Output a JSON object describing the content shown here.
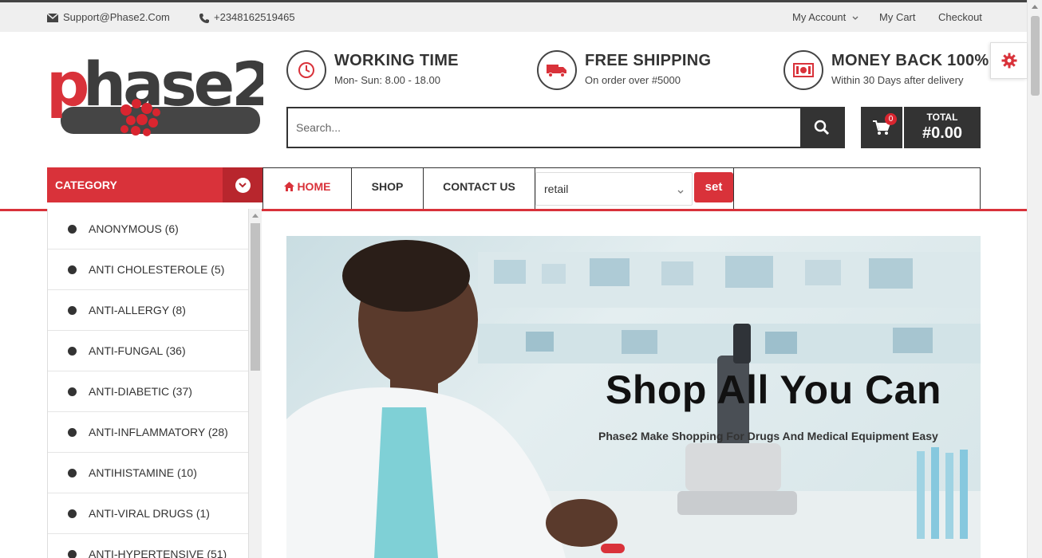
{
  "topbar": {
    "email": "Support@Phase2.Com",
    "phone": "+2348162519465",
    "my_account": "My Account",
    "my_cart": "My Cart",
    "checkout": "Checkout"
  },
  "info_blocks": [
    {
      "title": "WORKING TIME",
      "subtitle": "Mon- Sun: 8.00 - 18.00",
      "icon": "clock-icon"
    },
    {
      "title": "FREE SHIPPING",
      "subtitle": "On order over #5000",
      "icon": "truck-icon"
    },
    {
      "title": "MONEY BACK 100%",
      "subtitle": "Within 30 Days after delivery",
      "icon": "money-icon"
    }
  ],
  "search": {
    "placeholder": "Search..."
  },
  "cart": {
    "count": "0",
    "total_label": "TOTAL",
    "total_value": "#0.00"
  },
  "category": {
    "header": "CATEGORY"
  },
  "nav": {
    "home": "HOME",
    "shop": "SHOP",
    "contact": "CONTACT US",
    "select_value": "retail",
    "set_label": "set"
  },
  "categories": [
    "ANONYMOUS (6)",
    "ANTI CHOLESTEROLE (5)",
    "ANTI-ALLERGY (8)",
    "ANTI-FUNGAL (36)",
    "ANTI-DIABETIC (37)",
    "ANTI-INFLAMMATORY (28)",
    "ANTIHISTAMINE (10)",
    "ANTI-VIRAL DRUGS (1)",
    "ANTI-HYPERTENSIVE (51)"
  ],
  "banner": {
    "headline": "Shop All You Can",
    "tagline": "Phase2 Make Shopping For Drugs And Medical Equipment Easy"
  },
  "colors": {
    "accent": "#d9323a",
    "dark": "#333333"
  }
}
